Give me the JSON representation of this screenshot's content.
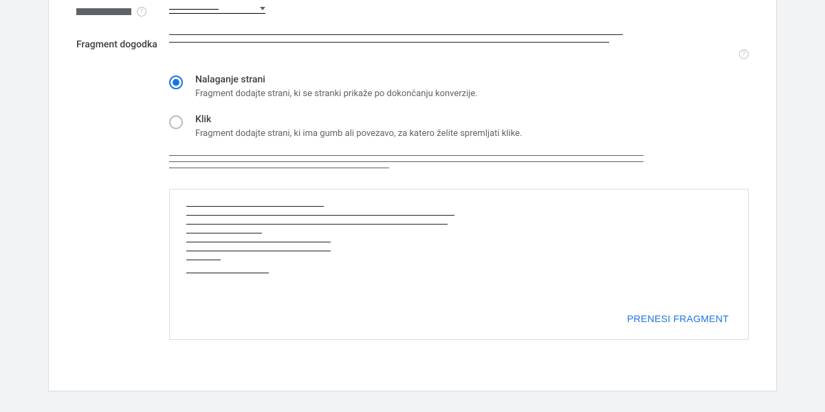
{
  "topRow": {
    "label_redacted": true
  },
  "section": {
    "label": "Fragment dogodka"
  },
  "options": [
    {
      "title": "Nalaganje strani",
      "desc": "Fragment dodajte strani, ki se stranki prikaže po dokončanju konverzije.",
      "selected": true
    },
    {
      "title": "Klik",
      "desc": "Fragment dodajte strani, ki ima gumb ali povezavo, za katero želite spremljati klike.",
      "selected": false
    }
  ],
  "download_button": "PRENESI FRAGMENT"
}
